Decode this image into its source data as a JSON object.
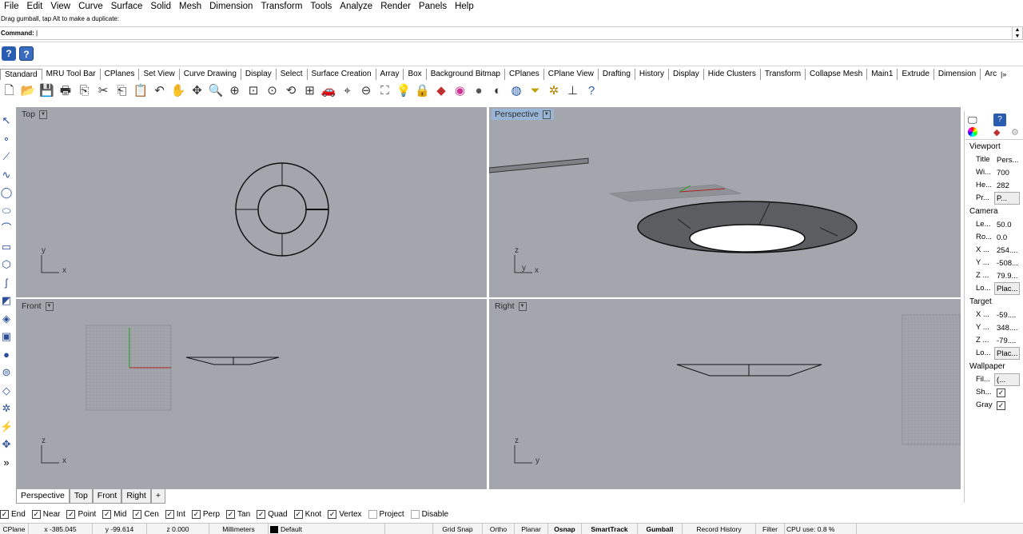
{
  "menu": [
    "File",
    "Edit",
    "View",
    "Curve",
    "Surface",
    "Solid",
    "Mesh",
    "Dimension",
    "Transform",
    "Tools",
    "Analyze",
    "Render",
    "Panels",
    "Help"
  ],
  "message": "Drag gumball, tap Alt to make a duplicate:",
  "command_label": "Command:",
  "tabs": [
    "Standard",
    "MRU Tool Bar",
    "CPlanes",
    "Set View",
    "Curve Drawing",
    "Display",
    "Select",
    "Surface Creation",
    "Array",
    "Box",
    "Background Bitmap",
    "CPlanes",
    "CPlane View",
    "Drafting",
    "History",
    "Display",
    "Hide Clusters",
    "Transform",
    "Collapse Mesh",
    "Main1",
    "Extrude",
    "Dimension",
    "Arc"
  ],
  "tab_more": "|»",
  "toolbar_icons": [
    "new-icon",
    "open-icon",
    "save-icon",
    "print-icon",
    "import-icon",
    "cut-icon",
    "copy-icon",
    "paste-icon",
    "undo-icon",
    "pan-icon",
    "rotate-view-icon",
    "zoom-icon",
    "zoom-window-icon",
    "zoom-extents-icon",
    "zoom-selected-icon",
    "rotate-icon",
    "four-viewports-icon",
    "car-icon",
    "lasso-icon",
    "cplane-icon",
    "options-icon",
    "light-icon",
    "lock-icon",
    "material-icon",
    "color-wheel-icon",
    "render-sphere-icon",
    "render-preview-icon",
    "environment-icon",
    "filter-icon",
    "gear-icon",
    "snap-icon",
    "help-icon"
  ],
  "viewports": {
    "top": {
      "title": "Top",
      "axis_a": "y",
      "axis_b": "x"
    },
    "perspective": {
      "title": "Perspective",
      "axis_a": "z",
      "axis_b": "y",
      "axis_c": "x"
    },
    "front": {
      "title": "Front",
      "axis_a": "z",
      "axis_b": "x"
    },
    "right": {
      "title": "Right",
      "axis_a": "z",
      "axis_b": "y"
    }
  },
  "viewport_tabs": [
    "Perspective",
    "Top",
    "Front",
    "Right"
  ],
  "viewport_tab_add": "+",
  "panel": {
    "viewport_section": "Viewport",
    "viewport_rows": [
      {
        "k": "Title",
        "v": "Pers..."
      },
      {
        "k": "Wi...",
        "v": "700"
      },
      {
        "k": "He...",
        "v": "282"
      },
      {
        "k": "Pr...",
        "v": "P..."
      }
    ],
    "camera_section": "Camera",
    "camera_rows": [
      {
        "k": "Le...",
        "v": "50.0"
      },
      {
        "k": "Ro...",
        "v": "0.0"
      },
      {
        "k": "X ...",
        "v": "254...."
      },
      {
        "k": "Y ...",
        "v": "-508...."
      },
      {
        "k": "Z ...",
        "v": "79.9..."
      },
      {
        "k": "Lo...",
        "v": "Plac..."
      }
    ],
    "target_section": "Target",
    "target_rows": [
      {
        "k": "X ...",
        "v": "-59...."
      },
      {
        "k": "Y ...",
        "v": "348...."
      },
      {
        "k": "Z ...",
        "v": "-79...."
      },
      {
        "k": "Lo...",
        "v": "Plac..."
      }
    ],
    "wallpaper_section": "Wallpaper",
    "wallpaper_rows": [
      {
        "k": "Fil...",
        "v": "(..."
      },
      {
        "k": "Sh...",
        "v": "✓"
      },
      {
        "k": "Gray",
        "v": "✓"
      }
    ]
  },
  "osnaps": [
    {
      "label": "End",
      "checked": true
    },
    {
      "label": "Near",
      "checked": true
    },
    {
      "label": "Point",
      "checked": true
    },
    {
      "label": "Mid",
      "checked": true
    },
    {
      "label": "Cen",
      "checked": true
    },
    {
      "label": "Int",
      "checked": true
    },
    {
      "label": "Perp",
      "checked": true
    },
    {
      "label": "Tan",
      "checked": true
    },
    {
      "label": "Quad",
      "checked": true
    },
    {
      "label": "Knot",
      "checked": true
    },
    {
      "label": "Vertex",
      "checked": true
    },
    {
      "label": "Project",
      "checked": false
    },
    {
      "label": "Disable",
      "checked": false
    }
  ],
  "status": {
    "cplane": "CPlane",
    "x": "x -385.045",
    "y": "y -99.614",
    "z": "z 0.000",
    "units": "Millimeters",
    "layer": "Default",
    "grid_snap": "Grid Snap",
    "ortho": "Ortho",
    "planar": "Planar",
    "osnap": "Osnap",
    "smarttrack": "SmartTrack",
    "gumball": "Gumball",
    "record_history": "Record History",
    "filter": "Filter",
    "cpu": "CPU use: 0.8 %"
  },
  "colors": {
    "viewport_bg": "#a3a7ad",
    "accent": "#2a5db0",
    "highlight": "#9ab6d6"
  }
}
